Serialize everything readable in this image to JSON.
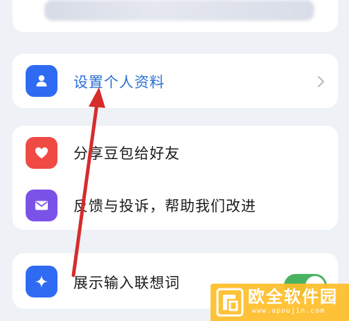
{
  "settings": {
    "items": [
      {
        "label": "设置个人资料",
        "icon": "person-icon",
        "color": "#2f6bf2"
      },
      {
        "label": "分享豆包给好友",
        "icon": "heart-icon",
        "color": "#f04a44"
      },
      {
        "label": "反馈与投诉，帮助我们改进",
        "icon": "mail-icon",
        "color": "#7b52e8"
      },
      {
        "label": "展示输入联想词",
        "icon": "sparkle-icon",
        "color": "#2f6bf2",
        "toggle_on": true
      }
    ]
  },
  "annotation": {
    "arrow_color": "#d62c2c"
  },
  "watermark": {
    "text": "欧全软件园",
    "url": "www.apoujin.com",
    "color": "#ffbe28"
  }
}
